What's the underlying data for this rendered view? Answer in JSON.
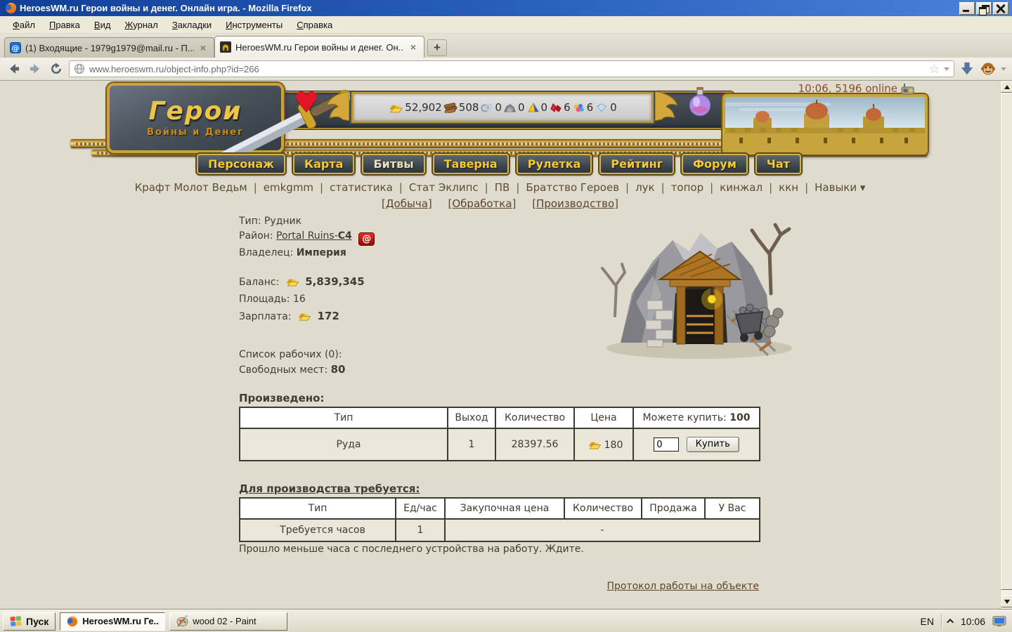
{
  "titlebar": {
    "title": "HeroesWM.ru Герои войны и денег. Онлайн игра. - Mozilla Firefox"
  },
  "menubar": {
    "items": [
      "Файл",
      "Правка",
      "Вид",
      "Журнал",
      "Закладки",
      "Инструменты",
      "Справка"
    ]
  },
  "tabs": {
    "tab1": "(1) Входящие - 1979g1979@mail.ru - П...",
    "tab2": "HeroesWM.ru Герои войны и денег. Он...",
    "new_tab": "+"
  },
  "toolbar": {
    "url": "www.heroeswm.ru/object-info.php?id=266"
  },
  "game": {
    "logo_title": "Герои",
    "logo_subtitle": "Войны и Денег",
    "status": "10:06, 5196 online",
    "resources": {
      "gold": "52,902",
      "wood": "508",
      "mercury": "0",
      "ore": "0",
      "sulfur": "0",
      "gems": "6",
      "crystals": "6",
      "diamonds": "0"
    },
    "nav": [
      "Персонаж",
      "Карта",
      "Битвы",
      "Таверна",
      "Рулетка",
      "Рейтинг",
      "Форум",
      "Чат"
    ],
    "subnav": [
      "Крафт Молот Ведьм",
      "emkgmm",
      "статистика",
      "Стат Эклипс",
      "ПВ",
      "Братство Героев",
      "лук",
      "топор",
      "кинжал",
      "ккн",
      "Навыки ▾"
    ],
    "section_links": [
      "[Добыча]",
      "[Обработка]",
      "[Производство]"
    ],
    "agent_icon_label": "@"
  },
  "object": {
    "type_label": "Тип:",
    "type_value": "Рудник",
    "district_label": "Район:",
    "district_link": "Portal Ruins-",
    "district_cell": "C4",
    "owner_label": "Владелец:",
    "owner_value": "Империя",
    "balance_label": "Баланс:",
    "balance_value": "5,839,345",
    "area_label": "Площадь:",
    "area_value": "16",
    "salary_label": "Зарплата:",
    "salary_value": "172",
    "workers_line": "Список рабочих (0):",
    "free_label": "Свободных мест:",
    "free_value": "80"
  },
  "produced_table": {
    "title": "Произведено:",
    "col_type": "Тип",
    "col_output": "Выход",
    "col_quantity": "Количество",
    "col_price": "Цена",
    "col_canbuy_label": "Можете купить:",
    "col_canbuy_value": "100",
    "row_type": "Руда",
    "row_output": "1",
    "row_quantity": "28397.56",
    "row_price": "180",
    "buy_input": "0",
    "buy_button": "Купить"
  },
  "requires_table": {
    "title": "Для производства требуется:",
    "col_type": "Тип",
    "col_per_hour": "Ед/час",
    "col_purchase": "Закупочная цена",
    "col_quantity": "Количество",
    "col_sale": "Продажа",
    "col_you": "У Вас",
    "row_type": "Требуется часов",
    "row_per_hour": "1",
    "row_rest": "-"
  },
  "messages": {
    "wait": "Прошло меньше часа с последнего устройства на работу. Ждите.",
    "protocol": "Протокол работы на объекте"
  },
  "taskbar": {
    "start": "Пуск",
    "task1": "HeroesWM.ru Ге...",
    "task2": "wood 02 - Paint",
    "lang": "EN",
    "time": "10:06"
  }
}
